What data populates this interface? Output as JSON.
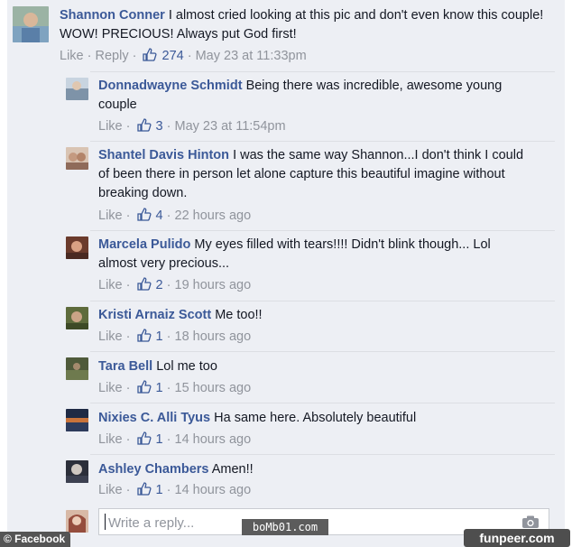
{
  "actions": {
    "like": "Like",
    "reply": "Reply"
  },
  "comments": [
    {
      "name": "Shannon Conner",
      "text": "I almost cried looking at this pic and don't even know this couple! WOW! PRECIOUS! Always put God first!",
      "likes": "274",
      "time": "May 23 at 11:33pm"
    }
  ],
  "replies": [
    {
      "name": "Donnadwayne Schmidt",
      "text": "Being there was incredible, awesome young couple",
      "likes": "3",
      "time": "May 23 at 11:54pm"
    },
    {
      "name": "Shantel Davis Hinton",
      "text": "I was the same way Shannon...I don't think I could of been there in person let alone capture this beautiful imagine without breaking down.",
      "likes": "4",
      "time": "22 hours ago"
    },
    {
      "name": "Marcela Pulido",
      "text": "My eyes filled with tears!!!! Didn't blink though... Lol almost very precious...",
      "likes": "2",
      "time": "19 hours ago"
    },
    {
      "name": "Kristi Arnaiz Scott",
      "text": "Me too!!",
      "likes": "1",
      "time": "18 hours ago"
    },
    {
      "name": "Tara Bell",
      "text": "Lol me too",
      "likes": "1",
      "time": "15 hours ago"
    },
    {
      "name": "Nixies C. Alli Tyus",
      "text": "Ha same here. Absolutely beautiful",
      "likes": "1",
      "time": "14 hours ago"
    },
    {
      "name": "Ashley Chambers",
      "text": "Amen!!",
      "likes": "1",
      "time": "14 hours ago"
    }
  ],
  "reply_input": {
    "placeholder": "Write a reply..."
  },
  "watermarks": {
    "left": "© Facebook",
    "middle": "boMb01.com",
    "right": "funpeer.com"
  },
  "colors": {
    "name_link": "#3b5998",
    "meta": "#90949c",
    "panel_bg": "#edeff4"
  }
}
